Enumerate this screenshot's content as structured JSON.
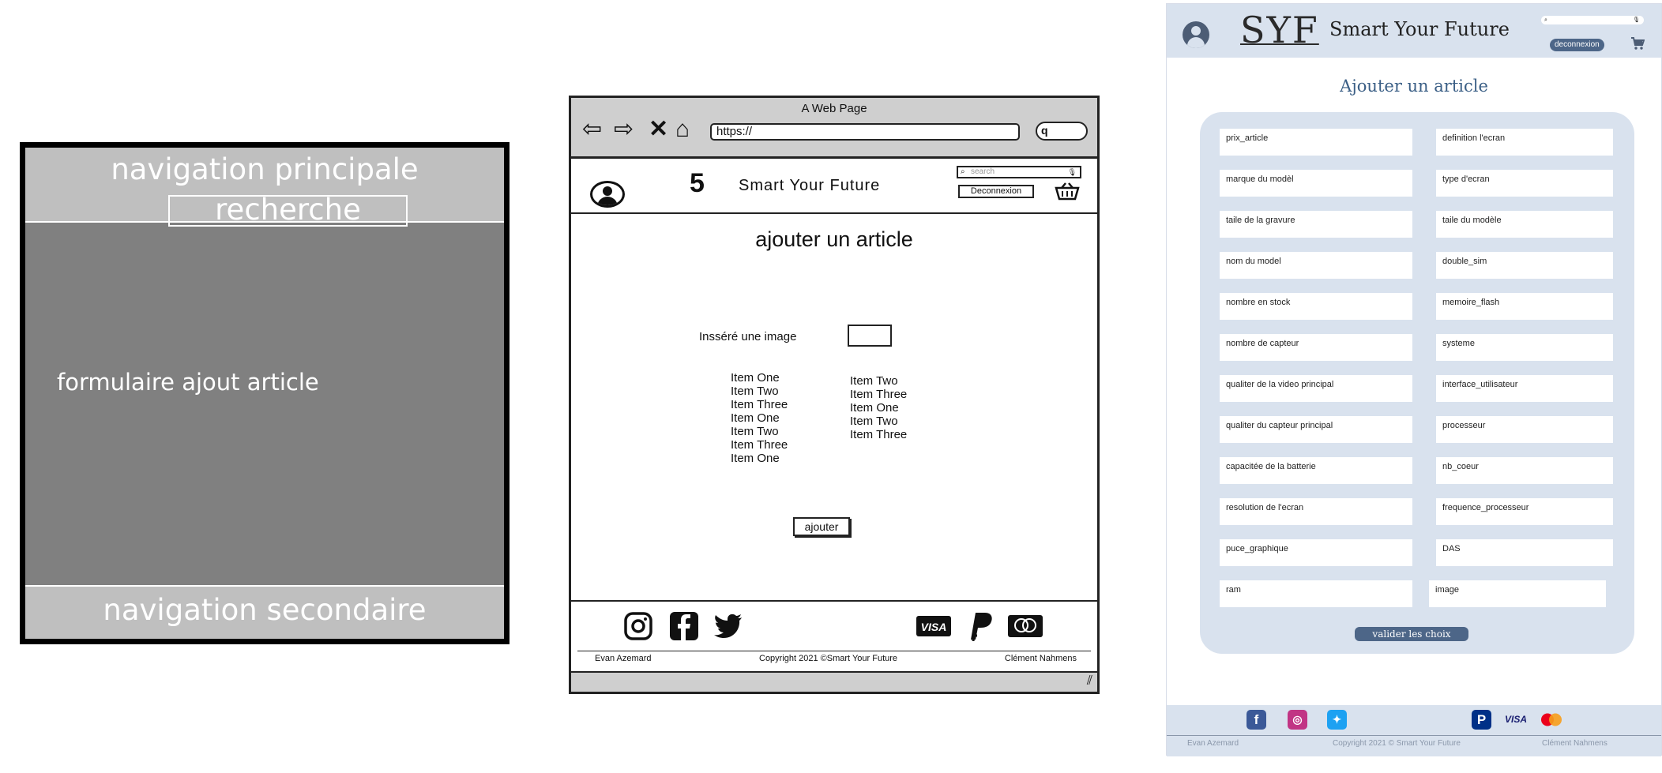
{
  "wireframe": {
    "top_nav_label": "navigation principale",
    "search_label": "recherche",
    "main_label": "formulaire ajout article",
    "bottom_nav_label": "navigation secondaire"
  },
  "sketch": {
    "window_title": "A Web Page",
    "url": "https://",
    "search_pill": "q",
    "brand": "Smart Your Future",
    "logo_glyph": "5",
    "search_placeholder": "search",
    "logout_label": "Deconnexion",
    "heading": "ajouter un article",
    "insert_image_label": "Insséré une image",
    "list_one": [
      "Item One",
      "Item Two",
      "Item Three",
      "Item One",
      "Item Two",
      "Item Three",
      "Item One"
    ],
    "list_two": [
      "Item Two",
      "Item Three",
      "Item One",
      "Item Two",
      "Item Three"
    ],
    "add_button": "ajouter",
    "footer": {
      "left": "Evan Azemard",
      "center": "Copyright 2021 ©Smart Your Future",
      "right": "Clément Nahmens",
      "visa": "VISA"
    }
  },
  "mockup": {
    "logo": "SYF",
    "brand": "Smart Your Future",
    "logout_label": "deconnexion",
    "heading": "Ajouter un article",
    "fields_left": [
      "prix_article",
      "marque du modèl",
      "taile de la gravure",
      "nom du model",
      "nombre en stock",
      "nombre de capteur",
      "qualiter de la video principal",
      "qualiter du capteur principal",
      "capacitée de la batterie",
      "resolution de l'ecran",
      "puce_graphique",
      "ram"
    ],
    "fields_right": [
      "definition l'ecran",
      "type d'ecran",
      "taile du modèle",
      "double_sim",
      "memoire_flash",
      "systeme",
      "interface_utilisateur",
      "processeur",
      "nb_coeur",
      "frequence_processeur",
      "DAS",
      "image"
    ],
    "submit_label": "valider les choix",
    "visa": "VISA",
    "footer": {
      "left": "Evan Azemard",
      "center": "Copyright 2021 © Smart Your Future",
      "right": "Clément Nahmens"
    },
    "colors": {
      "panel_bg": "#d9e2ee",
      "accent": "#4d6688",
      "heading": "#3b5f86"
    }
  }
}
